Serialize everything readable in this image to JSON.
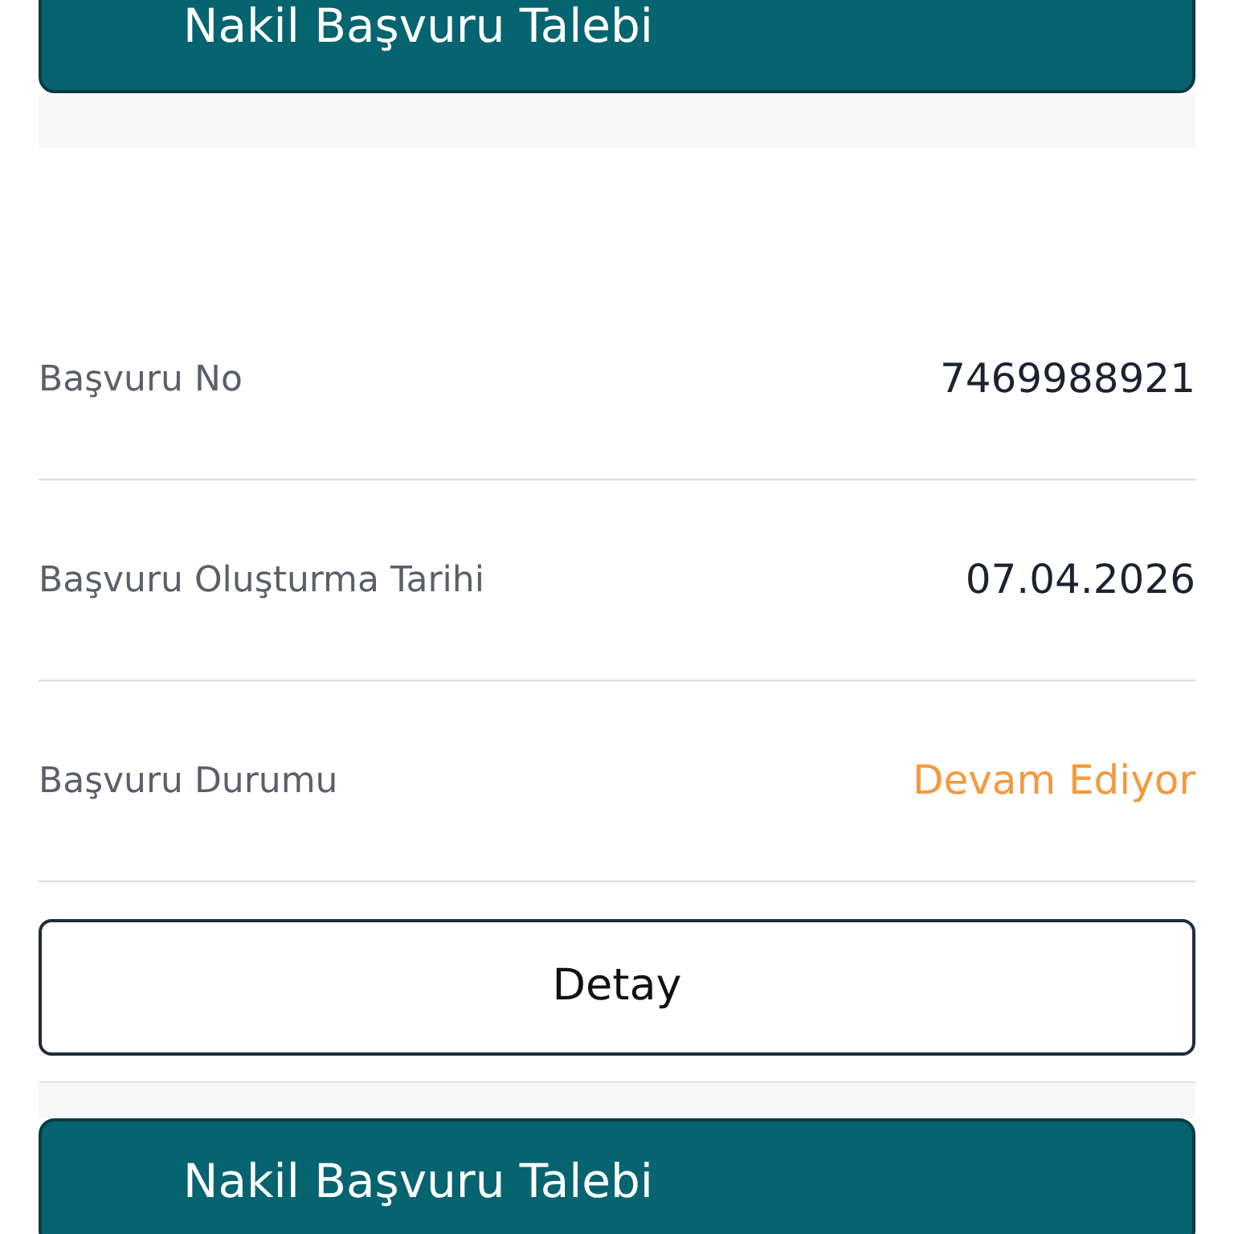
{
  "cards": [
    {
      "header": {
        "title": "Nakil Başvuru Talebi"
      },
      "details": [
        {
          "label": "Başvuru No",
          "value": "7469988921",
          "kind": "plain"
        },
        {
          "label": "Başvuru Oluşturma Tarihi",
          "value": "07.04.2026",
          "kind": "plain"
        },
        {
          "label": "Başvuru Durumu",
          "value": "Devam Ediyor",
          "kind": "status"
        }
      ],
      "button": "Detay"
    },
    {
      "header": {
        "title": "Nakil Başvuru Talebi"
      }
    }
  ]
}
